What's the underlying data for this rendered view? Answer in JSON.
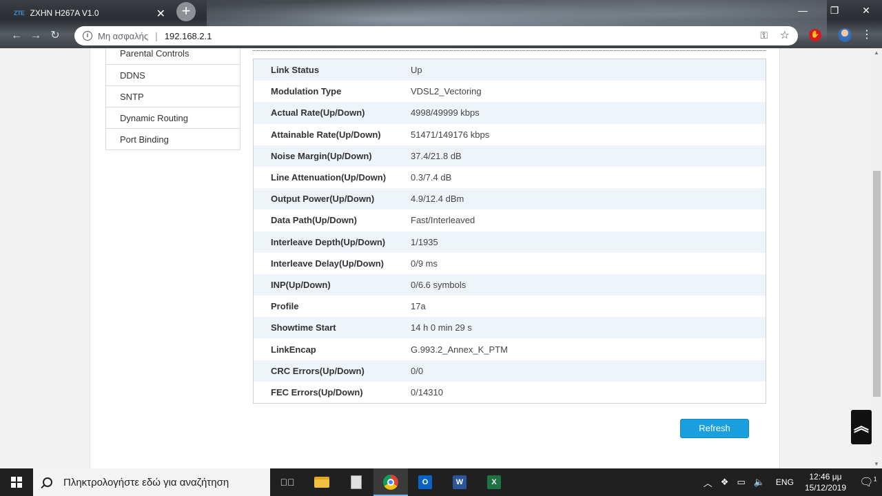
{
  "browser": {
    "tab_logo": "ZTE",
    "tab_title": "ZXHN H267A V1.0",
    "tab_close": "✕",
    "new_tab": "+",
    "security_label": "Μη ασφαλής",
    "url": "192.168.2.1"
  },
  "sidebar": {
    "items": [
      {
        "label": "Parental Controls"
      },
      {
        "label": "DDNS"
      },
      {
        "label": "SNTP"
      },
      {
        "label": "Dynamic Routing"
      },
      {
        "label": "Port Binding"
      }
    ]
  },
  "dsl_info": {
    "rows": [
      {
        "label": "Link Status",
        "value": "Up"
      },
      {
        "label": "Modulation Type",
        "value": "VDSL2_Vectoring"
      },
      {
        "label": "Actual Rate(Up/Down)",
        "value": "4998/49999 kbps"
      },
      {
        "label": "Attainable Rate(Up/Down)",
        "value": "51471/149176 kbps"
      },
      {
        "label": "Noise Margin(Up/Down)",
        "value": "37.4/21.8 dB"
      },
      {
        "label": "Line Attenuation(Up/Down)",
        "value": "0.3/7.4 dB"
      },
      {
        "label": "Output Power(Up/Down)",
        "value": "4.9/12.4 dBm"
      },
      {
        "label": "Data Path(Up/Down)",
        "value": "Fast/Interleaved"
      },
      {
        "label": "Interleave Depth(Up/Down)",
        "value": "1/1935"
      },
      {
        "label": "Interleave Delay(Up/Down)",
        "value": "0/9 ms"
      },
      {
        "label": "INP(Up/Down)",
        "value": "0/6.6 symbols"
      },
      {
        "label": "Profile",
        "value": "17a"
      },
      {
        "label": "Showtime Start",
        "value": "14 h 0 min 29 s"
      },
      {
        "label": "LinkEncap",
        "value": "G.993.2_Annex_K_PTM"
      },
      {
        "label": "CRC Errors(Up/Down)",
        "value": "0/0"
      },
      {
        "label": "FEC Errors(Up/Down)",
        "value": "0/14310"
      }
    ],
    "refresh_label": "Refresh"
  },
  "taskbar": {
    "search_placeholder": "Πληκτρολογήστε εδώ για αναζήτηση",
    "apps": [
      "task-view",
      "file-explorer",
      "calculator",
      "chrome",
      "outlook",
      "word",
      "excel"
    ],
    "outlook_letter": "O",
    "word_letter": "W",
    "excel_letter": "X",
    "language": "ENG",
    "time": "12:46 μμ",
    "date": "15/12/2019",
    "notification_count": "1"
  },
  "colors": {
    "accent_button": "#1aa0de",
    "row_alt": "#eef4fa",
    "taskbar": "#202020"
  }
}
